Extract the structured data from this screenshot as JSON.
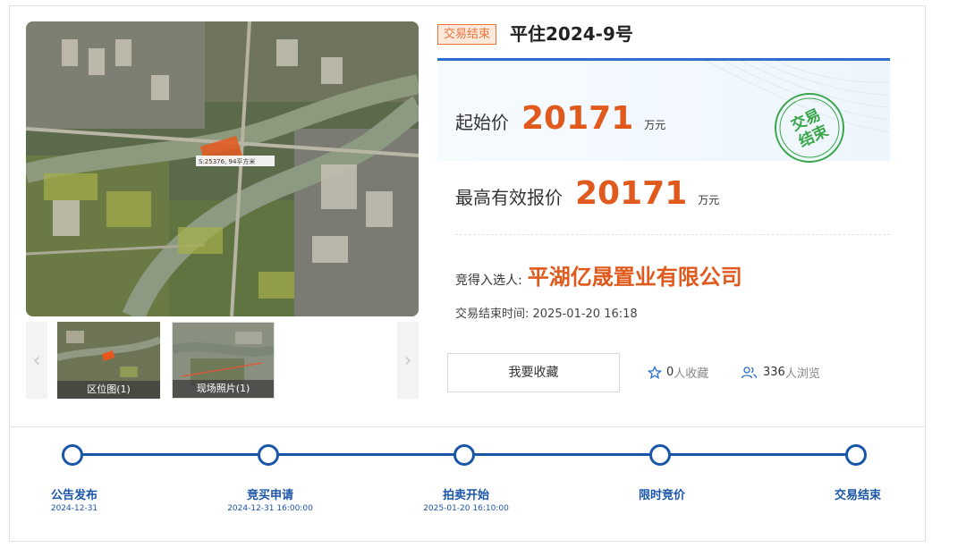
{
  "gallery": {
    "map_annotation": "S:25376, 94平方米",
    "thumbnails": [
      {
        "caption": "区位图(1)"
      },
      {
        "caption": "现场照片(1)"
      }
    ],
    "prev_icon": "chevron-left-icon",
    "next_icon": "chevron-right-icon"
  },
  "listing": {
    "status_tag": "交易结束",
    "title": "平住2024-9号",
    "start_price_label": "起始价",
    "start_price": "20171",
    "start_price_unit": "万元",
    "highest_price_label": "最高有效报价",
    "highest_price": "20171",
    "highest_price_unit": "万元",
    "stamp_text_line1": "交易",
    "stamp_text_line2": "结束",
    "winner_label": "竞得入选人:",
    "winner_name": "平湖亿晟置业有限公司",
    "end_time_label": "交易结束时间:",
    "end_time": "2025-01-20 16:18",
    "favorite_button": "我要收藏",
    "favorites_count": "0",
    "favorites_suffix": "人收藏",
    "views_count": "336",
    "views_suffix": "人浏览"
  },
  "timeline": {
    "steps": [
      {
        "label": "公告发布",
        "date": "2024-12-31"
      },
      {
        "label": "竞买申请",
        "date": "2024-12-31 16:00:00"
      },
      {
        "label": "拍卖开始",
        "date": "2025-01-20 16:10:00"
      },
      {
        "label": "限时竞价",
        "date": ""
      },
      {
        "label": "交易结束",
        "date": ""
      }
    ]
  },
  "colors": {
    "accent_blue": "#1a56a8",
    "price_orange": "#e15a1d",
    "stamp_green": "#3aa64a"
  }
}
